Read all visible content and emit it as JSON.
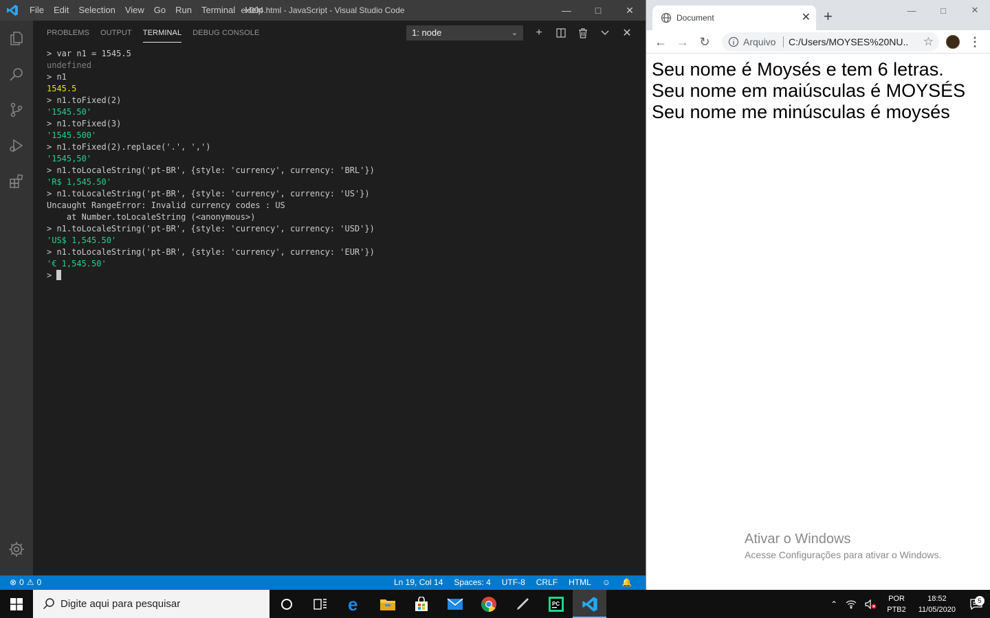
{
  "vscode": {
    "title": "ex004.html - JavaScript - Visual Studio Code",
    "menu": [
      "File",
      "Edit",
      "Selection",
      "View",
      "Go",
      "Run",
      "Terminal",
      "Help"
    ],
    "panel_tabs": [
      "PROBLEMS",
      "OUTPUT",
      "TERMINAL",
      "DEBUG CONSOLE"
    ],
    "active_tab": "TERMINAL",
    "terminal_select": "1: node",
    "terminal_lines": [
      {
        "text": "> var n1 = 1545.5",
        "kind": "cmd"
      },
      {
        "text": "undefined",
        "kind": "gray"
      },
      {
        "text": "> n1",
        "kind": "cmd"
      },
      {
        "text": "1545.5",
        "kind": "yellow"
      },
      {
        "text": "> n1.toFixed(2)",
        "kind": "cmd"
      },
      {
        "text": "'1545.50'",
        "kind": "green"
      },
      {
        "text": "> n1.toFixed(3)",
        "kind": "cmd"
      },
      {
        "text": "'1545.500'",
        "kind": "green"
      },
      {
        "text": "> n1.toFixed(2).replace('.', ',')",
        "kind": "cmd"
      },
      {
        "text": "'1545,50'",
        "kind": "green"
      },
      {
        "text": "> n1.toLocaleString('pt-BR', {style: 'currency', currency: 'BRL'})",
        "kind": "cmd"
      },
      {
        "text": "'R$ 1,545.50'",
        "kind": "green"
      },
      {
        "text": "> n1.toLocaleString('pt-BR', {style: 'currency', currency: 'US'})",
        "kind": "cmd"
      },
      {
        "text": "Uncaught RangeError: Invalid currency codes : US",
        "kind": "cmd"
      },
      {
        "text": "    at Number.toLocaleString (<anonymous>)",
        "kind": "cmd"
      },
      {
        "text": "> n1.toLocaleString('pt-BR', {style: 'currency', currency: 'USD'})",
        "kind": "cmd"
      },
      {
        "text": "'US$ 1,545.50'",
        "kind": "green"
      },
      {
        "text": "> n1.toLocaleString('pt-BR', {style: 'currency', currency: 'EUR'})",
        "kind": "cmd"
      },
      {
        "text": "'€ 1,545.50'",
        "kind": "green"
      }
    ],
    "prompt": ">",
    "status": {
      "errors": "0",
      "warnings": "0",
      "position": "Ln 19, Col 14",
      "spaces": "Spaces: 4",
      "encoding": "UTF-8",
      "eol": "CRLF",
      "language": "HTML"
    },
    "colors": {
      "statusbar": "#007acc",
      "titlebar": "#3c3c3c",
      "activity": "#333333",
      "editor": "#1e1e1e"
    }
  },
  "chrome": {
    "tab_title": "Document",
    "omnibox_label": "Arquivo",
    "url": "C:/Users/MOYSES%20NU...",
    "page_lines": [
      "Seu nome é Moysés e tem 6 letras.",
      "Seu nome em maiúsculas é MOYSÉS",
      "Seu nome me minúsculas é moysés"
    ]
  },
  "watermark": {
    "title": "Ativar o Windows",
    "subtitle": "Acesse Configurações para ativar o Windows."
  },
  "taskbar": {
    "search_placeholder": "Digite aqui para pesquisar",
    "lang_top": "POR",
    "lang_bottom": "PTB2",
    "time": "18:52",
    "date": "11/05/2020",
    "notifications": "5",
    "apps": [
      "cortana-icon",
      "task-view-icon",
      "edge-icon",
      "file-explorer-icon",
      "store-icon",
      "mail-icon",
      "chrome-icon",
      "pen-icon",
      "pycharm-icon",
      "vscode-icon"
    ]
  }
}
